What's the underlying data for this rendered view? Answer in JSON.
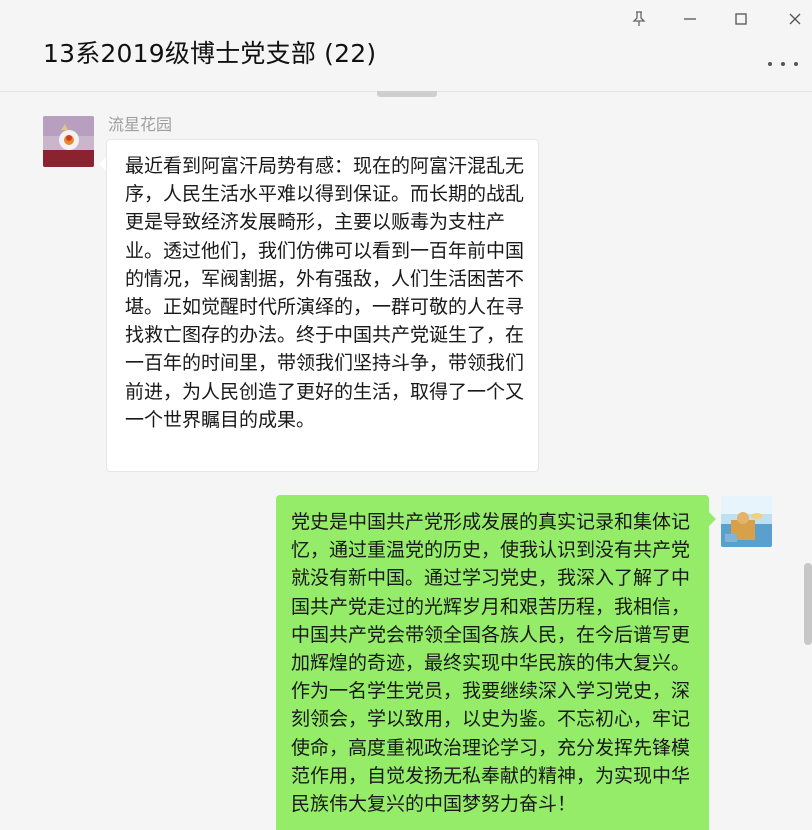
{
  "window": {
    "title": "13系2019级博士党支部 (22)",
    "pin_icon": "pin-icon",
    "minimize_icon": "minimize-icon",
    "maximize_icon": "maximize-icon",
    "close_icon": "close-icon",
    "more_icon": "more-options-icon"
  },
  "messages": [
    {
      "sender": "流星花园",
      "side": "left",
      "text": "最近看到阿富汗局势有感：现在的阿富汗混乱无序，人民生活水平难以得到保证。而长期的战乱更是导致经济发展畸形，主要以贩毒为支柱产业。透过他们，我们仿佛可以看到一百年前中国的情况，军阀割据，外有强敌，人们生活困苦不堪。正如觉醒时代所演绎的，一群可敬的人在寻找救亡图存的办法。终于中国共产党诞生了，在一百年的时间里，带领我们坚持斗争，带领我们前进，为人民创造了更好的生活，取得了一个又一个世界瞩目的成果。"
    },
    {
      "sender": "",
      "side": "right",
      "text": "党史是中国共产党形成发展的真实记录和集体记忆，通过重温党的历史，使我认识到没有共产党就没有新中国。通过学习党史，我深入了解了中国共产党走过的光辉岁月和艰苦历程，我相信，中国共产党会带领全国各族人民，在今后谱写更加辉煌的奇迹，最终实现中华民族的伟大复兴。作为一名学生党员，我要继续深入学习党史，深刻领会，学以致用，以史为鉴。不忘初心，牢记使命，高度重视政治理论学习，充分发挥先锋模范作用，自觉发扬无私奉献的精神，为实现中华民族伟大复兴的中国梦努力奋斗！"
    }
  ],
  "colors": {
    "background": "#f5f5f5",
    "own_bubble": "#95ec69",
    "other_bubble": "#ffffff",
    "sender_name": "#9e9e9e"
  }
}
